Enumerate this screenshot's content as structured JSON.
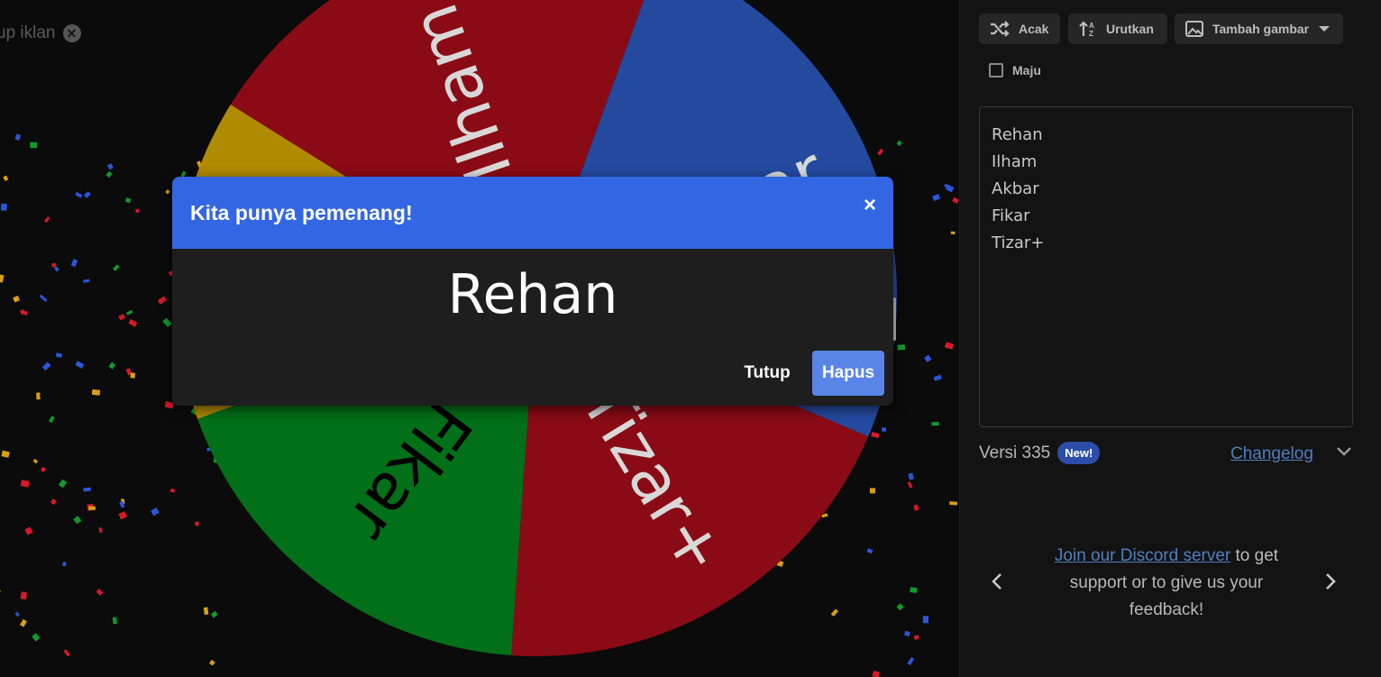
{
  "ad": {
    "close_label": "up iklan",
    "close_icon": "close-circle-icon"
  },
  "wheel": {
    "segments": [
      {
        "label": "Ilham",
        "color": "#8a0b16"
      },
      {
        "label": "Akbar",
        "color": "#244aa0"
      },
      {
        "label": "Tizar+",
        "color": "#8a0b16"
      },
      {
        "label": "Fikar",
        "color": "#027018"
      },
      {
        "label": "Rehan",
        "color": "#b08a00"
      }
    ]
  },
  "toolbar": {
    "shuffle_label": "Acak",
    "shuffle_icon": "shuffle-icon",
    "sort_label": "Urutkan",
    "sort_icon": "sort-icon",
    "add_image_label": "Tambah gambar",
    "add_image_icon": "image-icon"
  },
  "advanced": {
    "label": "Maju",
    "checked": false
  },
  "entries": [
    "Rehan",
    "Ilham",
    "Akbar",
    "Fikar",
    "Tizar+"
  ],
  "version": {
    "text": "Versi 335",
    "badge": "New!",
    "changelog": "Changelog"
  },
  "discord": {
    "link_text": "Join our Discord server",
    "rest_text": "to get support or to give us your feedback!"
  },
  "dialog": {
    "title": "Kita punya pemenang!",
    "close": "×",
    "winner": "Rehan",
    "close_button": "Tutup",
    "remove_button": "Hapus",
    "header_color": "#3366e3"
  }
}
